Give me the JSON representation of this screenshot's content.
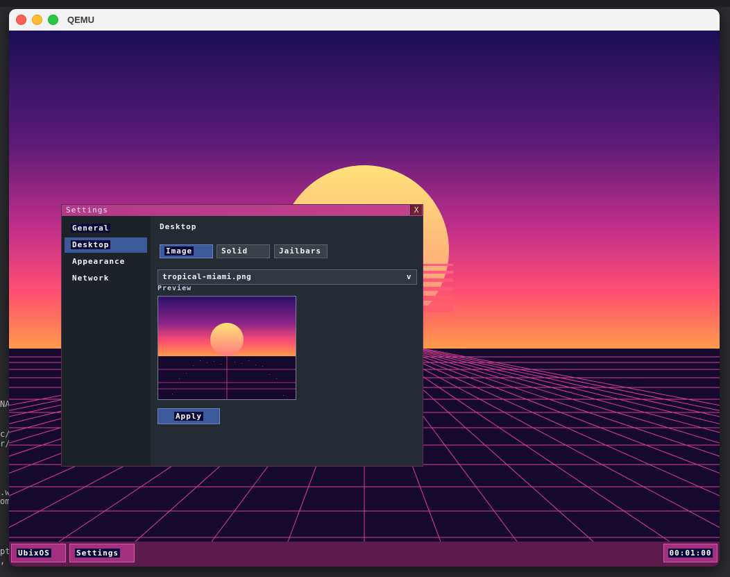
{
  "qemu": {
    "title": "QEMU"
  },
  "host": {
    "left_text": [
      "NA",
      "c/",
      "r/l",
      ".wa",
      "om",
      "pt",
      ", be"
    ]
  },
  "settings": {
    "title": "Settings",
    "close_label": "X",
    "sidebar": {
      "items": [
        {
          "label": "General",
          "active": false
        },
        {
          "label": "Desktop",
          "active": true
        },
        {
          "label": "Appearance",
          "active": false
        },
        {
          "label": "Network",
          "active": false
        }
      ]
    },
    "section_title": "Desktop",
    "tabs": [
      {
        "label": "Image",
        "active": true
      },
      {
        "label": "Solid",
        "active": false
      },
      {
        "label": "Jailbars",
        "active": false
      }
    ],
    "wallpaper_select": {
      "value": "tropical-miami.png",
      "arrow": "v"
    },
    "preview_label": "Preview",
    "apply_label": "Apply"
  },
  "taskbar": {
    "start_label": "UbixOS",
    "window_label": "Settings",
    "clock": "00:01:00"
  },
  "colors": {
    "sky_top": "#1a0f55",
    "sky_mid": "#c12f8a",
    "sky_horizon": "#ff9a4a",
    "sun_top": "#ffe27a",
    "sun_bottom": "#ff6f7f",
    "grid": "#e03c9a",
    "ground": "#150a2e",
    "accent": "#3c5a9a"
  }
}
